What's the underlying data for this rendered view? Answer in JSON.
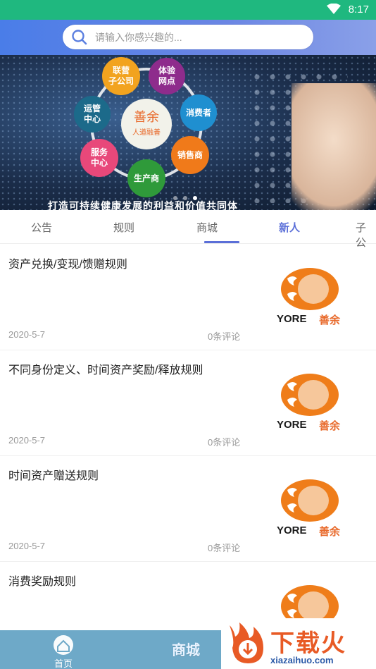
{
  "status_bar": {
    "time": "8:17",
    "icons": [
      "wifi-icon"
    ]
  },
  "search": {
    "placeholder": "请输入你感兴趣的..."
  },
  "banner": {
    "center_title": "善余",
    "center_subtitle": "人道融善",
    "segments": [
      "体验网点",
      "消费者",
      "销售商",
      "生产商",
      "服务中心",
      "运管中心",
      "联营子公司"
    ],
    "caption": "打造可持续健康发展的利益和价值共同体",
    "slide_count": 3,
    "active_slide": 2
  },
  "tabs": {
    "items": [
      "公告",
      "规则",
      "商城",
      "新人",
      "子公"
    ],
    "active": "新人"
  },
  "articles": [
    {
      "title": "资产兑换/变现/馈赠规则",
      "date": "2020-5-7",
      "comments": "0条评论",
      "thumb_text": "YORE",
      "thumb_cn": "善余"
    },
    {
      "title": "不同身份定义、时间资产奖励/释放规则",
      "date": "2020-5-7",
      "comments": "0条评论",
      "thumb_text": "YORE",
      "thumb_cn": "善余"
    },
    {
      "title": "时间资产赠送规则",
      "date": "2020-5-7",
      "comments": "0条评论",
      "thumb_text": "YORE",
      "thumb_cn": "善余"
    },
    {
      "title": "消费奖励规则",
      "date": "",
      "comments": "",
      "thumb_text": "",
      "thumb_cn": ""
    }
  ],
  "bottom_nav": {
    "home_label": "首页",
    "mall_label": "商城"
  },
  "watermark": {
    "brand": "下载火",
    "url": "xiazaihuo.com"
  },
  "colors": {
    "accent": "#5b6fd8",
    "status_bar": "#1fb87f",
    "nav": "#6ea9c8",
    "brand_orange": "#e8692a"
  }
}
